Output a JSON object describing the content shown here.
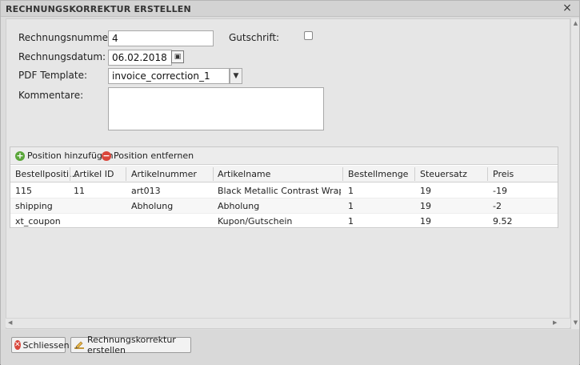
{
  "dialog": {
    "title": "RECHNUNGSKORREKTUR ERSTELLEN",
    "close_glyph": "×"
  },
  "form": {
    "rechnungsnummer": {
      "label": "Rechnungsnummer:",
      "value": "4"
    },
    "gutschrift": {
      "label": "Gutschrift:",
      "checked": false
    },
    "rechnungsdatum": {
      "label": "Rechnungsdatum:",
      "value": "06.02.2018"
    },
    "pdf_template": {
      "label": "PDF Template:",
      "value": "invoice_correction_1"
    },
    "kommentare": {
      "label": "Kommentare:",
      "value": ""
    }
  },
  "toolbar": {
    "add_label": "Position hinzufügen",
    "remove_label": "Position entfernen"
  },
  "grid": {
    "columns": [
      "Bestellpositi...",
      "Artikel ID",
      "Artikelnummer",
      "Artikelname",
      "Bestellmenge",
      "Steuersatz",
      "Preis"
    ],
    "rows": [
      [
        "115",
        "11",
        "art013",
        "Black Metallic Contrast Wrap Pl...",
        "1",
        "19",
        "-19"
      ],
      [
        "shipping",
        "",
        "Abholung",
        "Abholung",
        "1",
        "19",
        "-2"
      ],
      [
        "xt_coupon",
        "",
        "",
        "Kupon/Gutschein",
        "1",
        "19",
        "9.52"
      ]
    ]
  },
  "footer": {
    "close_label": "Schliessen",
    "create_label": "Rechnungskorrektur erstellen"
  },
  "colors": {
    "add_icon": "#5aa63a",
    "remove_icon": "#d9463b"
  }
}
